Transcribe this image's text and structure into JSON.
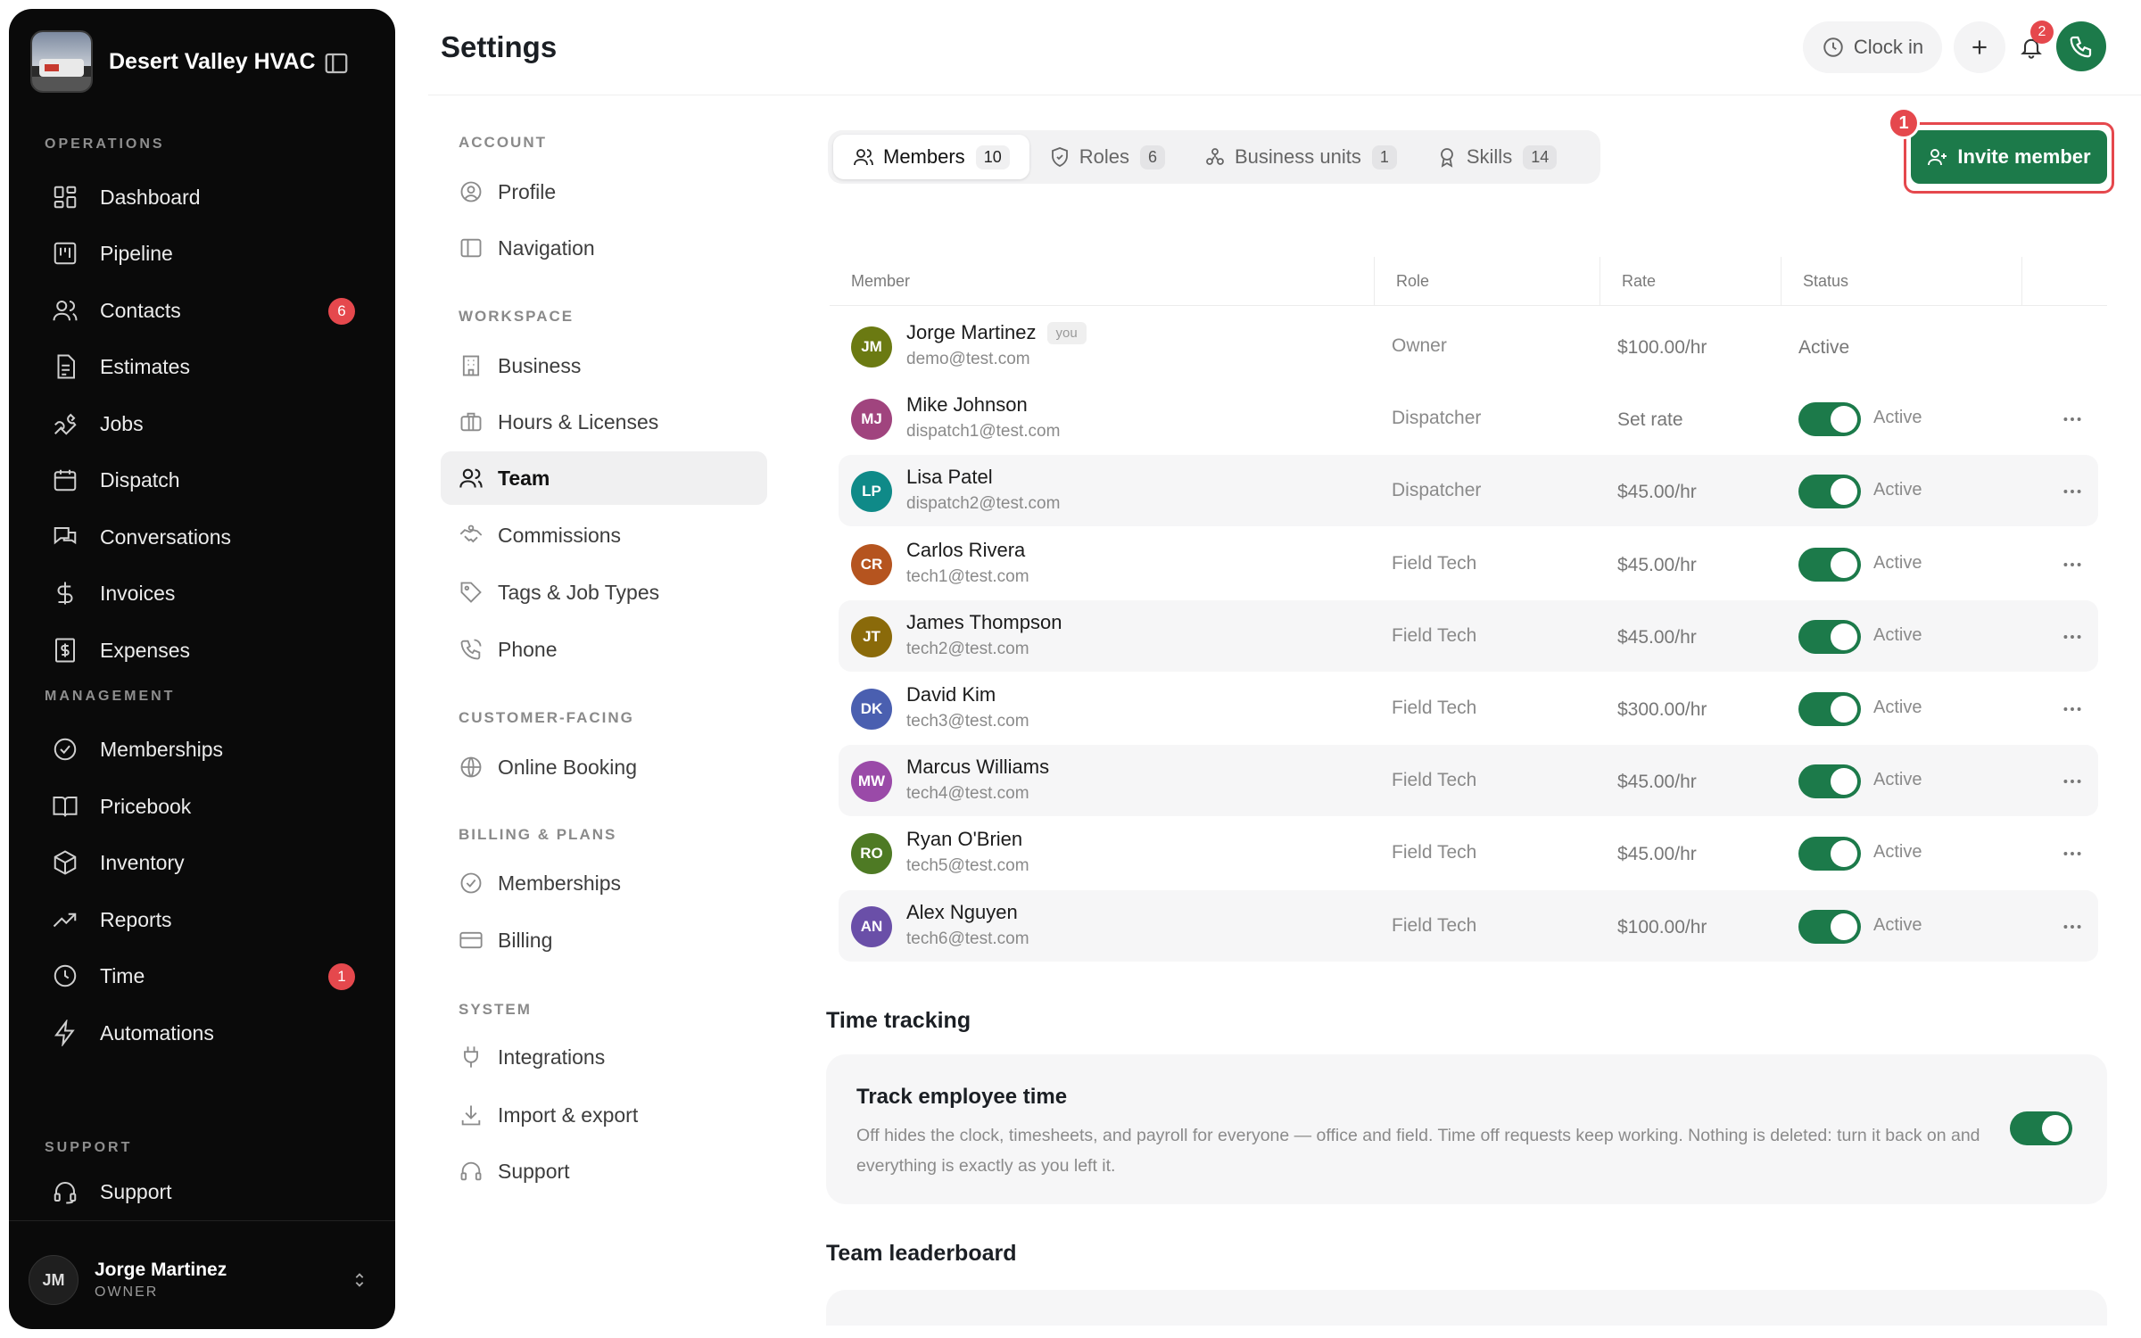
{
  "brand": {
    "name": "Desert Valley HVAC"
  },
  "sidebar": {
    "sections": {
      "operations": "OPERATIONS",
      "management": "MANAGEMENT",
      "support": "SUPPORT"
    },
    "items": [
      {
        "label": "Dashboard",
        "icon": "dashboard-icon"
      },
      {
        "label": "Pipeline",
        "icon": "pipeline-icon"
      },
      {
        "label": "Contacts",
        "icon": "contacts-icon",
        "badge": "6"
      },
      {
        "label": "Estimates",
        "icon": "estimates-icon"
      },
      {
        "label": "Jobs",
        "icon": "wrench-icon"
      },
      {
        "label": "Dispatch",
        "icon": "calendar-icon"
      },
      {
        "label": "Conversations",
        "icon": "chat-icon"
      },
      {
        "label": "Invoices",
        "icon": "dollar-icon"
      },
      {
        "label": "Expenses",
        "icon": "receipt-icon"
      },
      {
        "label": "Memberships",
        "icon": "check-circle-icon"
      },
      {
        "label": "Pricebook",
        "icon": "book-icon"
      },
      {
        "label": "Inventory",
        "icon": "box-icon"
      },
      {
        "label": "Reports",
        "icon": "trend-icon"
      },
      {
        "label": "Time",
        "icon": "clock-icon",
        "badge": "1"
      },
      {
        "label": "Automations",
        "icon": "bolt-icon"
      },
      {
        "label": "Support",
        "icon": "headset-icon"
      }
    ],
    "user": {
      "initials": "JM",
      "name": "Jorge Martinez",
      "role": "OWNER"
    }
  },
  "header": {
    "title": "Settings",
    "clock_in": "Clock in",
    "notifications": "2"
  },
  "settings_nav": {
    "sections": {
      "account": "ACCOUNT",
      "workspace": "WORKSPACE",
      "customer": "CUSTOMER-FACING",
      "billing": "BILLING & PLANS",
      "system": "SYSTEM"
    },
    "items": [
      {
        "label": "Profile"
      },
      {
        "label": "Navigation"
      },
      {
        "label": "Business"
      },
      {
        "label": "Hours & Licenses"
      },
      {
        "label": "Team"
      },
      {
        "label": "Commissions"
      },
      {
        "label": "Tags & Job Types"
      },
      {
        "label": "Phone"
      },
      {
        "label": "Online Booking"
      },
      {
        "label": "Memberships"
      },
      {
        "label": "Billing"
      },
      {
        "label": "Integrations"
      },
      {
        "label": "Import & export"
      },
      {
        "label": "Support"
      }
    ],
    "active": "Team"
  },
  "tabs": [
    {
      "label": "Members",
      "count": "10"
    },
    {
      "label": "Roles",
      "count": "6"
    },
    {
      "label": "Business units",
      "count": "1"
    },
    {
      "label": "Skills",
      "count": "14"
    }
  ],
  "invite": {
    "label": "Invite member",
    "step": "1"
  },
  "table": {
    "headers": [
      "Member",
      "Role",
      "Rate",
      "Status"
    ],
    "you_badge": "you",
    "rows": [
      {
        "initials": "JM",
        "color": "#6b7a12",
        "name": "Jorge Martinez",
        "email": "demo@test.com",
        "role": "Owner",
        "rate": "$100.00/hr",
        "status": "Active",
        "toggle": false,
        "you": true
      },
      {
        "initials": "MJ",
        "color": "#a0447e",
        "name": "Mike Johnson",
        "email": "dispatch1@test.com",
        "role": "Dispatcher",
        "rate": "Set rate",
        "status": "Active",
        "toggle": true
      },
      {
        "initials": "LP",
        "color": "#0f8a88",
        "name": "Lisa Patel",
        "email": "dispatch2@test.com",
        "role": "Dispatcher",
        "rate": "$45.00/hr",
        "status": "Active",
        "toggle": true
      },
      {
        "initials": "CR",
        "color": "#b5541f",
        "name": "Carlos Rivera",
        "email": "tech1@test.com",
        "role": "Field Tech",
        "rate": "$45.00/hr",
        "status": "Active",
        "toggle": true
      },
      {
        "initials": "JT",
        "color": "#8a6a0a",
        "name": "James Thompson",
        "email": "tech2@test.com",
        "role": "Field Tech",
        "rate": "$45.00/hr",
        "status": "Active",
        "toggle": true
      },
      {
        "initials": "DK",
        "color": "#4a5fb0",
        "name": "David Kim",
        "email": "tech3@test.com",
        "role": "Field Tech",
        "rate": "$300.00/hr",
        "status": "Active",
        "toggle": true
      },
      {
        "initials": "MW",
        "color": "#9a4aa8",
        "name": "Marcus Williams",
        "email": "tech4@test.com",
        "role": "Field Tech",
        "rate": "$45.00/hr",
        "status": "Active",
        "toggle": true
      },
      {
        "initials": "RO",
        "color": "#4e7a24",
        "name": "Ryan O'Brien",
        "email": "tech5@test.com",
        "role": "Field Tech",
        "rate": "$45.00/hr",
        "status": "Active",
        "toggle": true
      },
      {
        "initials": "AN",
        "color": "#6a4fa8",
        "name": "Alex Nguyen",
        "email": "tech6@test.com",
        "role": "Field Tech",
        "rate": "$100.00/hr",
        "status": "Active",
        "toggle": true
      }
    ]
  },
  "time_tracking": {
    "heading": "Time tracking",
    "card_title": "Track employee time",
    "card_desc": "Off hides the clock, timesheets, and payroll for everyone — office and field. Time off requests keep working. Nothing is deleted: turn it back on and everything is exactly as you left it."
  },
  "leaderboard": {
    "heading": "Team leaderboard"
  },
  "colors": {
    "accent": "#1c7a4a",
    "badge": "#e5484d",
    "sidebar_bg": "#0a0a0a"
  }
}
